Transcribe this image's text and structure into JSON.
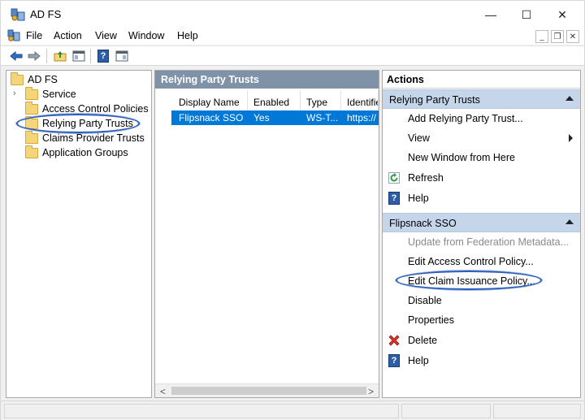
{
  "window": {
    "title": "AD FS"
  },
  "title_controls": {
    "minimize": "—",
    "maximize": "☐",
    "close": "✕"
  },
  "menubar": {
    "items": [
      "File",
      "Action",
      "View",
      "Window",
      "Help"
    ]
  },
  "mdi_controls": {
    "minimize": "_",
    "restore": "❐",
    "close": "✕"
  },
  "toolbar": {
    "icons": [
      "back-arrow-icon",
      "forward-arrow-icon",
      "up-folder-icon",
      "show-hide-tree-icon",
      "help-icon",
      "show-hide-action-pane-icon"
    ]
  },
  "tree": {
    "root": "AD FS",
    "items": [
      {
        "label": "Service",
        "expandable": true
      },
      {
        "label": "Access Control Policies",
        "expandable": false
      },
      {
        "label": "Relying Party Trusts",
        "expandable": false,
        "selected": true
      },
      {
        "label": "Claims Provider Trusts",
        "expandable": false
      },
      {
        "label": "Application Groups",
        "expandable": false
      }
    ]
  },
  "center": {
    "header": "Relying Party Trusts",
    "columns": [
      "Display Name",
      "Enabled",
      "Type",
      "Identifie"
    ],
    "rows": [
      {
        "display_name": "Flipsnack SSO",
        "enabled": "Yes",
        "type": "WS-T...",
        "identifier": "https://"
      }
    ],
    "scroll_left": "<",
    "scroll_right": ">"
  },
  "actions": {
    "title": "Actions",
    "section1": {
      "title": "Relying Party Trusts",
      "items": [
        {
          "label": "Add Relying Party Trust...",
          "icon": ""
        },
        {
          "label": "View",
          "icon": "",
          "submenu": true
        },
        {
          "label": "New Window from Here",
          "icon": ""
        },
        {
          "label": "Refresh",
          "icon": "refresh-icon"
        },
        {
          "label": "Help",
          "icon": "help-icon"
        }
      ]
    },
    "section2": {
      "title": "Flipsnack SSO",
      "items": [
        {
          "label": "Update from Federation Metadata...",
          "icon": "",
          "disabled": true
        },
        {
          "label": "Edit Access Control Policy...",
          "icon": ""
        },
        {
          "label": "Edit Claim Issuance Policy...",
          "icon": "",
          "highlighted": true
        },
        {
          "label": "Disable",
          "icon": ""
        },
        {
          "label": "Properties",
          "icon": ""
        },
        {
          "label": "Delete",
          "icon": "delete-icon"
        },
        {
          "label": "Help",
          "icon": "help-icon"
        }
      ]
    }
  },
  "help_glyph": "?",
  "colors": {
    "pane_header": "#7f92a8",
    "selection": "#0078d7",
    "section_bg": "#c6d6ea",
    "annotation_ellipse": "#2a5db8"
  }
}
